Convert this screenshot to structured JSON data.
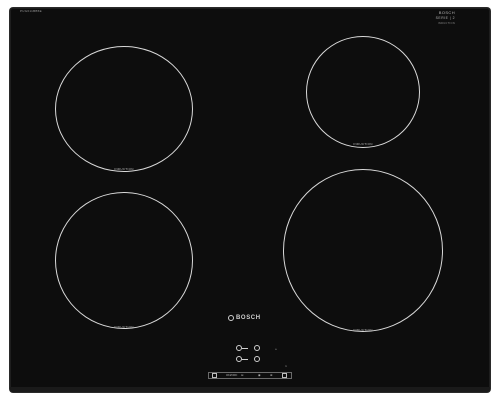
{
  "product": {
    "model_code": "PUG611BB5E",
    "badge_line1": "BOSCH",
    "badge_line2": "SERIE | 2",
    "badge_line3": "INDUCTION",
    "brand": "BOSCH"
  },
  "zones": [
    {
      "name": "front-left-zone",
      "label": "INDUCTION"
    },
    {
      "name": "rear-left-zone",
      "label": "INDUCTION"
    },
    {
      "name": "rear-right-zone",
      "label": "INDUCTION"
    },
    {
      "name": "front-right-zone",
      "label": "INDUCTION"
    }
  ],
  "controls": {
    "strip_labels": [
      "ON/OFF",
      "⊖",
      "◉",
      "⊕"
    ],
    "timer_label": "⏲",
    "lock_label": "🔒"
  },
  "colors": {
    "glass": "#0d0d0d",
    "ring": "#d9d9d9",
    "text": "#bfbfbf"
  }
}
